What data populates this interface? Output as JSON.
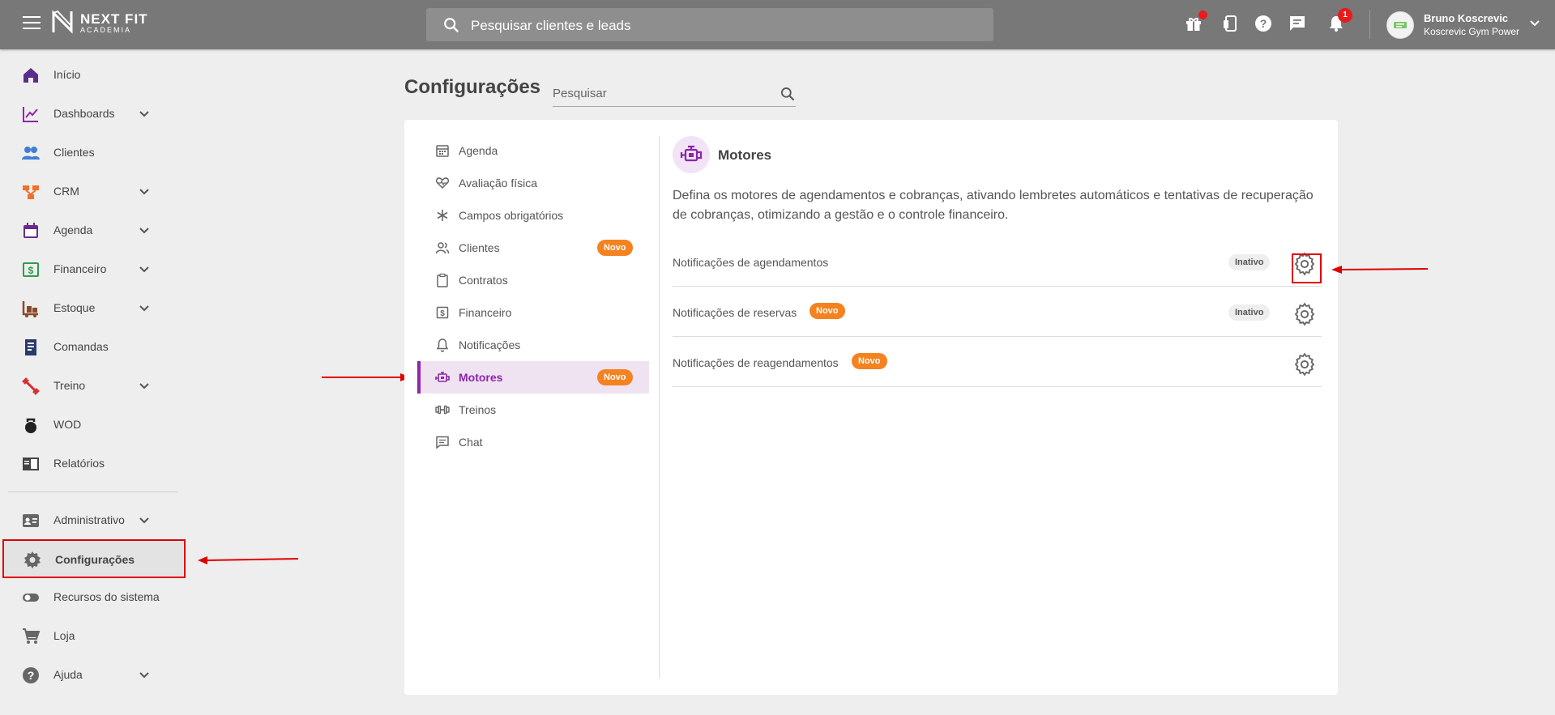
{
  "topbar": {
    "logo_name": "NEXT FIT",
    "logo_sub": "ACADEMIA",
    "search_placeholder": "Pesquisar clientes e leads",
    "notifications_count": "1",
    "user_name": "Bruno Koscrevic",
    "user_org": "Koscrevic Gym Power"
  },
  "sidebar": {
    "items": [
      {
        "label": "Início",
        "icon": "home-icon",
        "color": "#5b2d8a"
      },
      {
        "label": "Dashboards",
        "icon": "chart-line-icon",
        "color": "#8e24aa"
      },
      {
        "label": "Clientes",
        "icon": "people-icon",
        "color": "#3f7fd6"
      },
      {
        "label": "CRM",
        "icon": "crm-icon",
        "color": "#f0702a"
      },
      {
        "label": "Agenda",
        "icon": "calendar-icon",
        "color": "#6a2a8a"
      },
      {
        "label": "Financeiro",
        "icon": "money-icon",
        "color": "#2e9c4a"
      },
      {
        "label": "Estoque",
        "icon": "stock-icon",
        "color": "#8a4a2a"
      },
      {
        "label": "Comandas",
        "icon": "receipt-icon",
        "color": "#2a3a6a"
      },
      {
        "label": "Treino",
        "icon": "dumbbell-icon",
        "color": "#d92a2a"
      },
      {
        "label": "WOD",
        "icon": "kettlebell-icon",
        "color": "#222222"
      },
      {
        "label": "Relatórios",
        "icon": "report-icon",
        "color": "#444444"
      },
      {
        "label": "Administrativo",
        "icon": "id-card-icon",
        "color": "#666666"
      },
      {
        "label": "Configurações",
        "icon": "gear-icon",
        "color": "#666666"
      },
      {
        "label": "Recursos do sistema",
        "icon": "toggle-icon",
        "color": "#666666"
      },
      {
        "label": "Loja",
        "icon": "cart-icon",
        "color": "#666666"
      },
      {
        "label": "Ajuda",
        "icon": "help-icon",
        "color": "#666666"
      }
    ]
  },
  "page": {
    "title": "Configurações",
    "search_placeholder": "Pesquisar"
  },
  "config_menu": {
    "new_badge": "Novo",
    "items": [
      {
        "label": "Agenda",
        "icon": "calendar-icon"
      },
      {
        "label": "Avaliação física",
        "icon": "heart-pulse-icon"
      },
      {
        "label": "Campos obrigatórios",
        "icon": "asterisk-icon"
      },
      {
        "label": "Clientes",
        "icon": "users-icon"
      },
      {
        "label": "Contratos",
        "icon": "clipboard-icon"
      },
      {
        "label": "Financeiro",
        "icon": "dollar-icon"
      },
      {
        "label": "Notificações",
        "icon": "bell-icon"
      },
      {
        "label": "Motores",
        "icon": "engine-icon"
      },
      {
        "label": "Treinos",
        "icon": "dumbbell-icon"
      },
      {
        "label": "Chat",
        "icon": "chat-icon"
      }
    ]
  },
  "panel": {
    "title": "Motores",
    "description": "Defina os motores de agendamentos e cobranças, ativando lembretes automáticos e tentativas de recuperação de cobranças, otimizando a gestão e o controle financeiro.",
    "rows": [
      {
        "label": "Notificações de agendamentos",
        "status": "Inativo",
        "badge": ""
      },
      {
        "label": "Notificações de reservas",
        "status": "Inativo",
        "badge": "Novo"
      },
      {
        "label": "Notificações de reagendamentos",
        "status": "",
        "badge": "Novo"
      }
    ]
  }
}
